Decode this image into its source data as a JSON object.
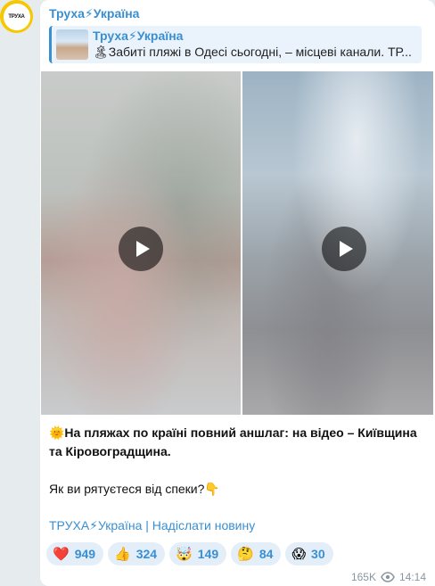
{
  "avatar": {
    "text": "ТРУХА",
    "color": "#f5c800"
  },
  "post": {
    "channel_name": "Труха⚡Україна",
    "reply": {
      "title": "Труха⚡Україна",
      "text": "🏝Забиті пляжі в Одесі сьогодні, – місцеві канали. ТР..."
    },
    "caption_line1": "🌞На пляжах по країні повний аншлаг: на відео – Київщина та Кіровоградщина.",
    "caption_line2": "Як ви рятуєтеся від спеки?👇",
    "footer_link": "ТРУХА⚡Україна | Надіслати новину",
    "reactions": [
      {
        "emoji": "❤️",
        "count": "949"
      },
      {
        "emoji": "👍",
        "count": "324"
      },
      {
        "emoji": "🤯",
        "count": "149"
      },
      {
        "emoji": "🤔",
        "count": "84"
      },
      {
        "emoji": "😱",
        "count": "30"
      }
    ],
    "views": "165K",
    "time": "14:14"
  },
  "colors": {
    "accent": "#3a8fd1",
    "background": "#e6ebee",
    "bubble": "#ffffff"
  },
  "icons": {
    "play": "play-icon",
    "views": "eye-icon"
  }
}
